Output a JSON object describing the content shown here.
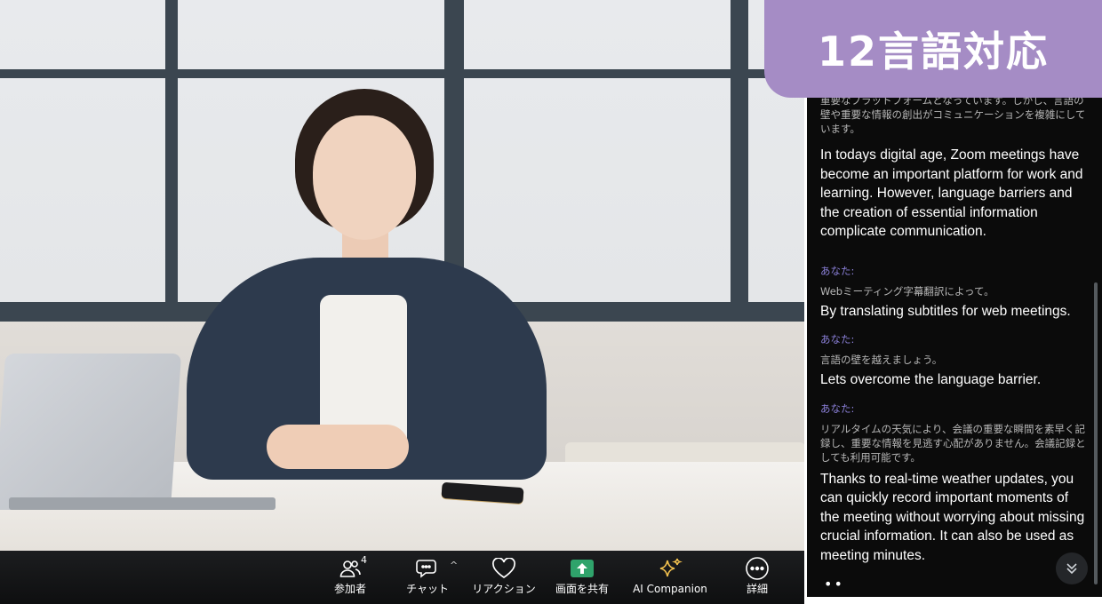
{
  "banner": {
    "text": "12言語対応"
  },
  "toolbar": {
    "participants": {
      "label": "参加者",
      "count": "4"
    },
    "chat": {
      "label": "チャット"
    },
    "reactions": {
      "label": "リアクション"
    },
    "share": {
      "label": "画面を共有"
    },
    "ai_companion": {
      "label": "AI Companion"
    },
    "more": {
      "label": "詳細"
    }
  },
  "captions": {
    "top_partial_jp": "重要なプラットフォームとなっています。しかし、言語の壁や重要な情報の創出がコミュニケーションを複雑にしています。",
    "top_en": "In todays digital age, Zoom meetings have become an important platform for work and learning. However, language barriers and the creation of essential information complicate communication.",
    "entries": [
      {
        "speaker": "あなた:",
        "jp": "Webミーティング字幕翻訳によって。",
        "en": "By translating subtitles for web meetings."
      },
      {
        "speaker": "あなた:",
        "jp": "言語の壁を越えましょう。",
        "en": "Lets overcome the language barrier."
      },
      {
        "speaker": "あなた:",
        "jp": "リアルタイムの天気により、会議の重要な瞬間を素早く記録し、重要な情報を見逃す心配がありません。会議記録としても利用可能です。",
        "en": "Thanks to real-time weather updates, you can quickly record important moments of the meeting without worrying about missing crucial information. It can also be used as meeting minutes."
      }
    ],
    "typing_indicator": "••"
  },
  "colors": {
    "banner": "#a58cc5",
    "speaker": "#8b80d9",
    "share_green": "#2fa36b",
    "sparkle": "#f2c14e"
  },
  "icons": [
    "participants-icon",
    "chat-icon",
    "heart-icon",
    "share-screen-icon",
    "sparkle-icon",
    "more-icon",
    "chevron-down-double-icon"
  ]
}
